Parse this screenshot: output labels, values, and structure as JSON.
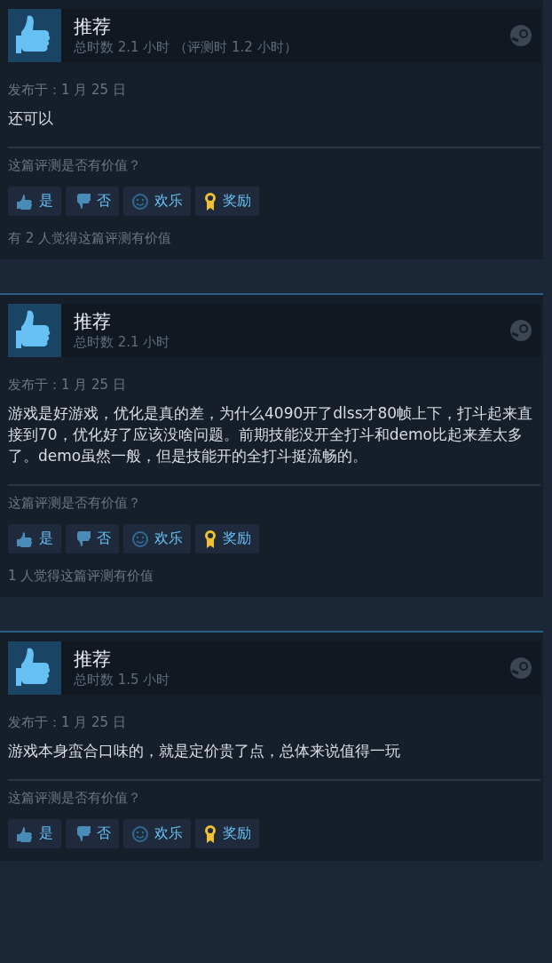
{
  "reviews": [
    {
      "verdict": "推荐",
      "hours": "总时数 2.1 小时 （评测时 1.2 小时）",
      "posted": "发布于：1 月 25 日",
      "text": "还可以",
      "helpful_prompt": "这篇评测是否有价值？",
      "buttons": [
        {
          "kind": "yes",
          "label": "是"
        },
        {
          "kind": "no",
          "label": "否"
        },
        {
          "kind": "funny",
          "label": "欢乐"
        },
        {
          "kind": "award",
          "label": "奖励"
        }
      ],
      "helpful_count": "有 2 人觉得这篇评测有价值",
      "highlighted": false
    },
    {
      "verdict": "推荐",
      "hours": "总时数 2.1 小时",
      "posted": "发布于：1 月 25 日",
      "text": "游戏是好游戏，优化是真的差，为什么4090开了dlss才80帧上下，打斗起来直接到70，优化好了应该没啥问题。前期技能没开全打斗和demo比起来差太多了。demo虽然一般，但是技能开的全打斗挺流畅的。",
      "helpful_prompt": "这篇评测是否有价值？",
      "buttons": [
        {
          "kind": "yes",
          "label": "是"
        },
        {
          "kind": "no",
          "label": "否"
        },
        {
          "kind": "funny",
          "label": "欢乐"
        },
        {
          "kind": "award",
          "label": "奖励"
        }
      ],
      "helpful_count": "1 人觉得这篇评测有价值",
      "highlighted": true
    },
    {
      "verdict": "推荐",
      "hours": "总时数 1.5 小时",
      "posted": "发布于：1 月 25 日",
      "text": "游戏本身蛮合口味的，就是定价贵了点，总体来说值得一玩",
      "helpful_prompt": "这篇评测是否有价值？",
      "buttons": [
        {
          "kind": "yes",
          "label": "是"
        },
        {
          "kind": "no",
          "label": "否"
        },
        {
          "kind": "funny",
          "label": "欢乐"
        },
        {
          "kind": "award",
          "label": "奖励"
        }
      ],
      "highlighted": true
    }
  ]
}
